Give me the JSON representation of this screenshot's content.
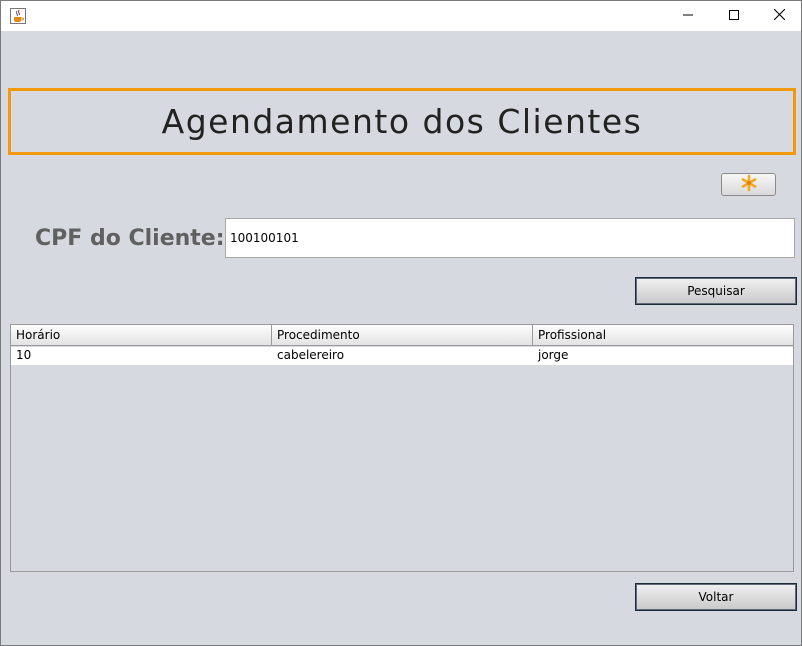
{
  "window": {
    "icon": "java-cup-icon",
    "controls": [
      "minimize-icon",
      "maximize-icon",
      "close-icon"
    ]
  },
  "header": {
    "title": "Agendamento dos Clientes",
    "border_color": "#f29a0e"
  },
  "toolbar": {
    "icon_button_icon": "asterisk-icon",
    "icon_color": "#f5a623"
  },
  "search": {
    "label": "CPF do Cliente:",
    "value": "100100101",
    "button_label": "Pesquisar"
  },
  "table": {
    "columns": [
      "Horário",
      "Procedimento",
      "Profissional"
    ],
    "rows": [
      [
        "10",
        "cabelereiro",
        "jorge"
      ]
    ]
  },
  "footer": {
    "back_label": "Voltar"
  }
}
